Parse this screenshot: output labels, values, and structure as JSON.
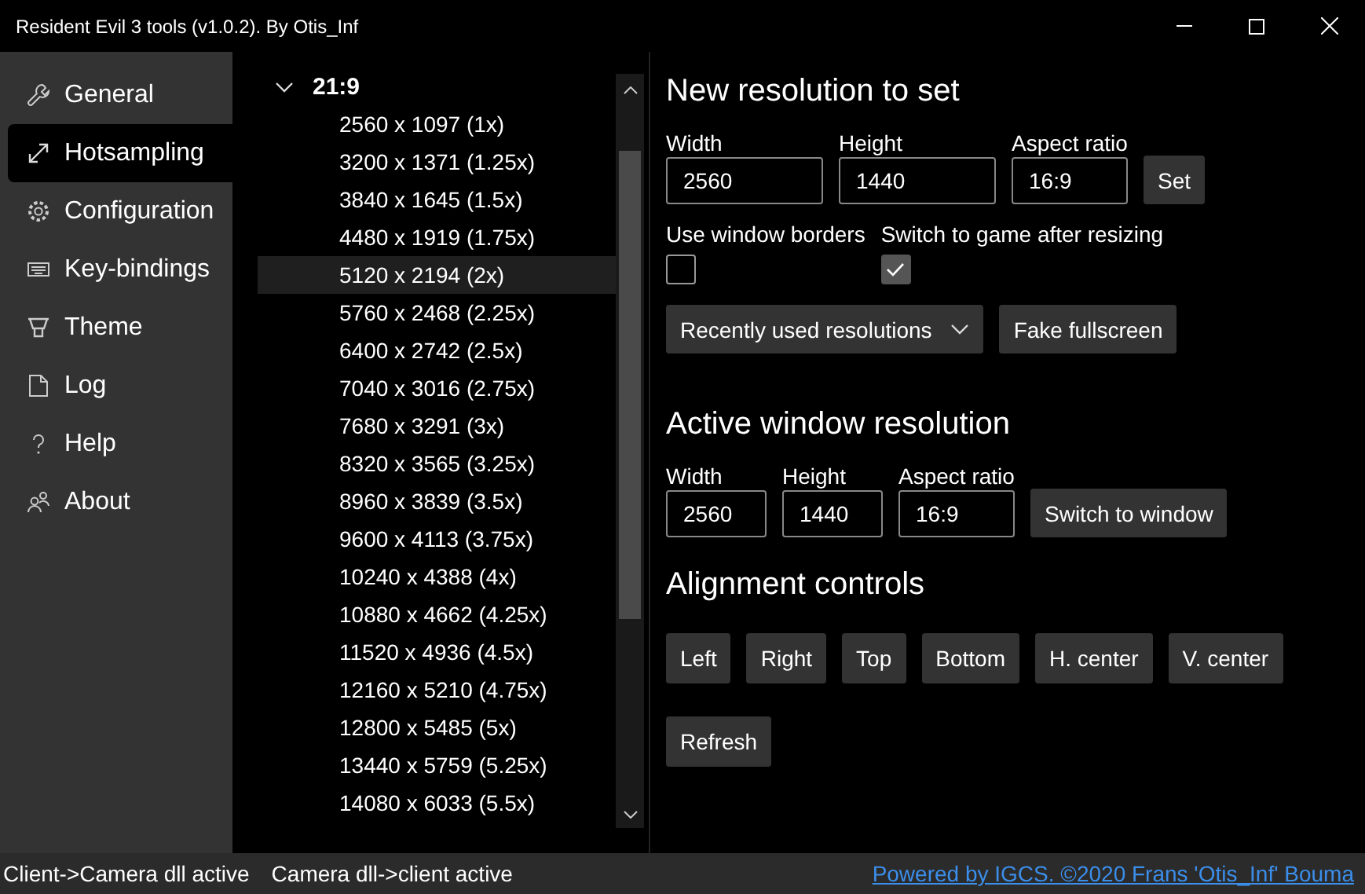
{
  "window": {
    "title": "Resident Evil 3 tools (v1.0.2). By Otis_Inf"
  },
  "sidebar": {
    "items": [
      {
        "label": "General",
        "kind": "wrench",
        "selected": false
      },
      {
        "label": "Hotsampling",
        "kind": "resize",
        "selected": true
      },
      {
        "label": "Configuration",
        "kind": "gear",
        "selected": false
      },
      {
        "label": "Key-bindings",
        "kind": "keyboard",
        "selected": false
      },
      {
        "label": "Theme",
        "kind": "brush",
        "selected": false
      },
      {
        "label": "Log",
        "kind": "document",
        "selected": false
      },
      {
        "label": "Help",
        "kind": "question",
        "selected": false
      },
      {
        "label": "About",
        "kind": "people",
        "selected": false
      }
    ]
  },
  "tree": {
    "label": "21:9",
    "expanded": true,
    "children": [
      {
        "label": "2560 x 1097 (1x)",
        "selected": false
      },
      {
        "label": "3200 x 1371 (1.25x)",
        "selected": false
      },
      {
        "label": "3840 x 1645 (1.5x)",
        "selected": false
      },
      {
        "label": "4480 x 1919 (1.75x)",
        "selected": false
      },
      {
        "label": "5120 x 2194 (2x)",
        "selected": true
      },
      {
        "label": "5760 x 2468 (2.25x)",
        "selected": false
      },
      {
        "label": "6400 x 2742 (2.5x)",
        "selected": false
      },
      {
        "label": "7040 x 3016 (2.75x)",
        "selected": false
      },
      {
        "label": "7680 x 3291 (3x)",
        "selected": false
      },
      {
        "label": "8320 x 3565 (3.25x)",
        "selected": false
      },
      {
        "label": "8960 x 3839 (3.5x)",
        "selected": false
      },
      {
        "label": "9600 x 4113 (3.75x)",
        "selected": false
      },
      {
        "label": "10240 x 4388 (4x)",
        "selected": false
      },
      {
        "label": "10880 x 4662 (4.25x)",
        "selected": false
      },
      {
        "label": "11520 x 4936 (4.5x)",
        "selected": false
      },
      {
        "label": "12160 x 5210 (4.75x)",
        "selected": false
      },
      {
        "label": "12800 x 5485 (5x)",
        "selected": false
      },
      {
        "label": "13440 x 5759 (5.25x)",
        "selected": false
      },
      {
        "label": "14080 x 6033 (5.5x)",
        "selected": false
      }
    ]
  },
  "new_resolution": {
    "heading": "New resolution to set",
    "fields": [
      {
        "label": "Width",
        "value": "2560"
      },
      {
        "label": "Height",
        "value": "1440"
      },
      {
        "label": "Aspect ratio",
        "value": "16:9"
      }
    ],
    "set_button": "Set",
    "checkboxes": [
      {
        "label": "Use window borders",
        "checked": false
      },
      {
        "label": "Switch to game after resizing",
        "checked": true
      }
    ],
    "dropdown": {
      "label": "Recently used resolutions"
    },
    "fake_fullscreen_button": "Fake fullscreen"
  },
  "active_window": {
    "heading": "Active window resolution",
    "fields": [
      {
        "label": "Width",
        "value": "2560"
      },
      {
        "label": "Height",
        "value": "1440"
      },
      {
        "label": "Aspect ratio",
        "value": "16:9"
      }
    ],
    "button": "Switch to window"
  },
  "alignment": {
    "heading": "Alignment controls",
    "buttons": [
      "Left",
      "Right",
      "Top",
      "Bottom",
      "H. center",
      "V. center"
    ],
    "refresh_button": "Refresh"
  },
  "status_bar": {
    "items": [
      "Client->Camera dll active",
      "Camera dll->client active"
    ],
    "link": "Powered by IGCS. ©2020 Frans 'Otis_Inf' Bouma"
  }
}
